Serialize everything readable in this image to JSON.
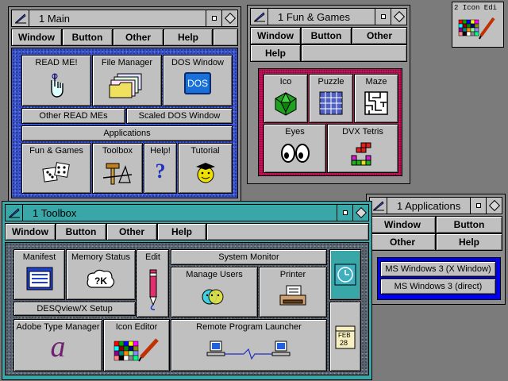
{
  "main": {
    "title": "1  Main",
    "menu": [
      "Window",
      "Button",
      "Other",
      "Help"
    ],
    "buttons": {
      "readme": "READ ME!",
      "file_manager": "File Manager",
      "dos_window": "DOS Window",
      "dos_icon_text": "DOS",
      "other_readmes": "Other READ MEs",
      "scaled_dos": "Scaled DOS Window",
      "applications": "Applications",
      "fun_games": "Fun & Games",
      "toolbox": "Toolbox",
      "help": "Help!",
      "tutorial": "Tutorial"
    }
  },
  "fun": {
    "title": "1  Fun & Games",
    "menu": [
      "Window",
      "Button",
      "Other",
      "Help"
    ],
    "buttons": {
      "ico": "Ico",
      "puzzle": "Puzzle",
      "maze": "Maze",
      "eyes": "Eyes",
      "tetris": "DVX Tetris"
    }
  },
  "icon_editor_mini": {
    "title": "2 Icon Edi"
  },
  "applications": {
    "title": "1  Applications",
    "menu": [
      "Window",
      "Button",
      "Other",
      "Help"
    ],
    "items": [
      "MS Windows 3 (X Window)",
      "MS Windows 3 (direct)"
    ]
  },
  "toolbox": {
    "title": "1  Toolbox",
    "menu": [
      "Window",
      "Button",
      "Other",
      "Help"
    ],
    "buttons": {
      "manifest": "Manifest",
      "memory_status": "Memory Status",
      "memory_icon_text": "?K",
      "edit": "Edit",
      "system_monitor": "System Monitor",
      "manage_users": "Manage Users",
      "printer": "Printer",
      "desqview_setup": "DESQview/X Setup",
      "adobe_type_manager": "Adobe Type Manager",
      "adobe_glyph": "a",
      "icon_editor": "Icon Editor",
      "remote_launcher": "Remote Program Launcher",
      "calendar_month": "FEB",
      "calendar_day": "28"
    }
  },
  "colors": {
    "desktop": "#7b7b7b",
    "window_gray": "#8c8c8c",
    "window_teal": "#39a7a7",
    "client_blue": "#3a52c8",
    "client_magenta": "#c4145c",
    "bright_blue": "#0000f0",
    "button": "#c0c0c0"
  }
}
